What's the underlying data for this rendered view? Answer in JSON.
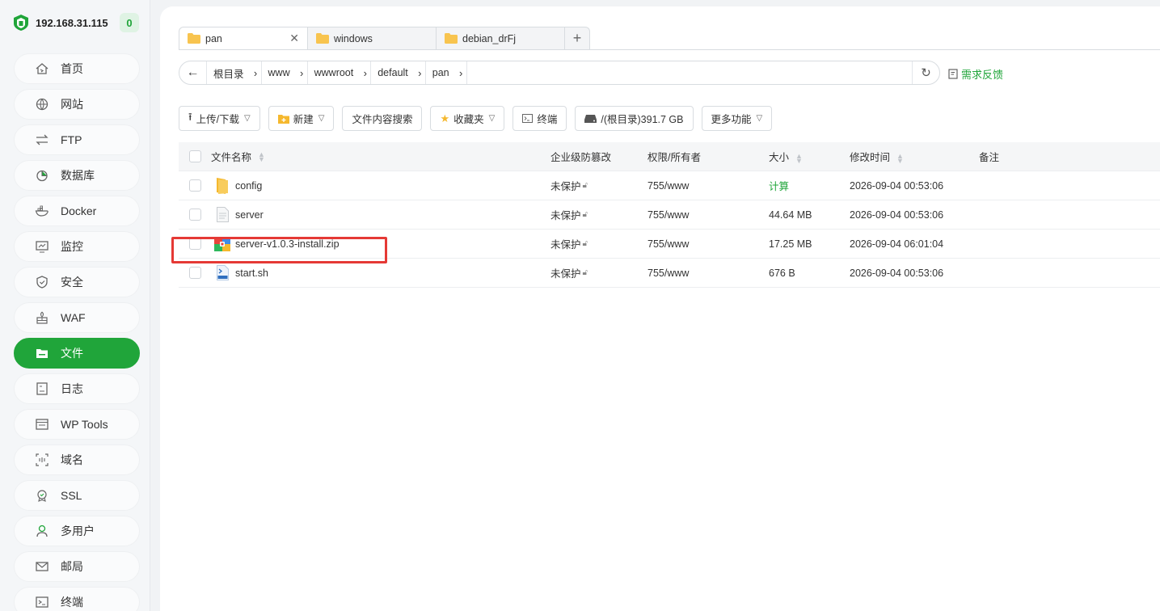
{
  "sidebar": {
    "server_ip": "192.168.31.115",
    "badge_count": "0",
    "items": [
      {
        "label": "首页",
        "icon": "home-icon"
      },
      {
        "label": "网站",
        "icon": "globe-icon"
      },
      {
        "label": "FTP",
        "icon": "transfer-icon"
      },
      {
        "label": "数据库",
        "icon": "database-icon"
      },
      {
        "label": "Docker",
        "icon": "docker-icon"
      },
      {
        "label": "监控",
        "icon": "monitor-icon"
      },
      {
        "label": "安全",
        "icon": "shield-icon"
      },
      {
        "label": "WAF",
        "icon": "waf-icon"
      },
      {
        "label": "文件",
        "icon": "folder-icon",
        "active": true
      },
      {
        "label": "日志",
        "icon": "log-icon"
      },
      {
        "label": "WP Tools",
        "icon": "wp-tools-icon"
      },
      {
        "label": "域名",
        "icon": "domain-icon"
      },
      {
        "label": "SSL",
        "icon": "ssl-icon"
      },
      {
        "label": "多用户",
        "icon": "user-icon"
      },
      {
        "label": "邮局",
        "icon": "mail-icon"
      },
      {
        "label": "终端",
        "icon": "terminal-icon"
      }
    ]
  },
  "tabs": [
    {
      "label": "pan",
      "active": true,
      "close": "✕"
    },
    {
      "label": "windows"
    },
    {
      "label": "debian_drFj"
    }
  ],
  "tab_add": "+",
  "breadcrumb": [
    "根目录",
    "www",
    "wwwroot",
    "default",
    "pan"
  ],
  "feedback": "需求反馈",
  "toolbar": {
    "upload": "上传/下载",
    "new": "新建",
    "search": "文件内容搜索",
    "favorites": "收藏夹",
    "terminal": "终端",
    "disk": "/(根目录)391.7 GB",
    "more": "更多功能"
  },
  "table": {
    "headers": {
      "name": "文件名称",
      "protection": "企业级防篡改",
      "permission": "权限/所有者",
      "size": "大小",
      "modified": "修改时间",
      "note": "备注"
    },
    "rows": [
      {
        "name": "config",
        "type": "folder",
        "protection": "未保护",
        "permission": "755/www",
        "size": "计算",
        "modified": "2026-09-04 00:53:06",
        "note": ""
      },
      {
        "name": "server",
        "type": "file",
        "protection": "未保护",
        "permission": "755/www",
        "size": "44.64 MB",
        "modified": "2026-09-04 00:53:06",
        "note": ""
      },
      {
        "name": "server-v1.0.3-install.zip",
        "type": "zip",
        "protection": "未保护",
        "permission": "755/www",
        "size": "17.25 MB",
        "modified": "2026-09-04 06:01:04",
        "note": ""
      },
      {
        "name": "start.sh",
        "type": "shell",
        "protection": "未保护",
        "permission": "755/www",
        "size": "676 B",
        "modified": "2026-09-04 00:53:06",
        "note": ""
      }
    ]
  },
  "colors": {
    "accent": "#20a53a",
    "highlight": "#e53935"
  }
}
